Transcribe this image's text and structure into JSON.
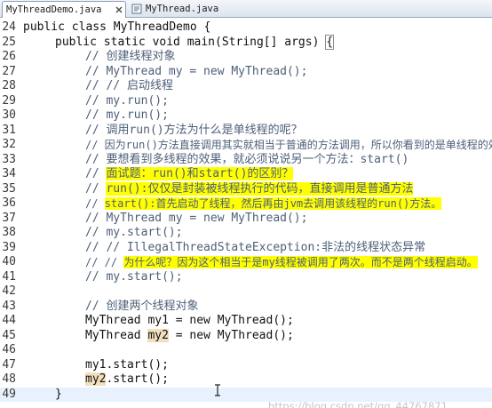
{
  "tabs": [
    {
      "label": "MyThreadDemo.java",
      "active": true,
      "close_icon": "close-icon"
    },
    {
      "label": "MyThread.java",
      "active": false,
      "icon": "java-file-icon"
    }
  ],
  "editor": {
    "lines": [
      {
        "number": "24",
        "text": "public class MyThreadDemo {",
        "kind": "code"
      },
      {
        "number": "25",
        "text": "public static void main(String[] args) ",
        "bracket": "{",
        "kind": "code"
      },
      {
        "number": "26",
        "text": "// 创建线程对象",
        "kind": "comment"
      },
      {
        "number": "27",
        "text": "// MyThread my = new MyThread();",
        "kind": "comment"
      },
      {
        "number": "28",
        "text": "// // 启动线程",
        "kind": "comment"
      },
      {
        "number": "29",
        "text": "// my.run();",
        "kind": "comment"
      },
      {
        "number": "30",
        "text": "// my.run();",
        "kind": "comment"
      },
      {
        "number": "31",
        "text": "// 调用run()方法为什么是单线程的呢？",
        "kind": "comment"
      },
      {
        "number": "32",
        "text": "// 因为run()方法直接调用其实就相当于普通的方法调用，所以你看到的是单线程的效果",
        "kind": "comment"
      },
      {
        "number": "33",
        "text": "// 要想看到多线程的效果，就必须说说另一个方法：start()",
        "kind": "comment"
      },
      {
        "number": "34",
        "prefix": "// ",
        "text": "面试题：run()和start()的区别？",
        "kind": "comment",
        "highlight": true
      },
      {
        "number": "35",
        "prefix": "// ",
        "text": "run():仅仅是封装被线程执行的代码，直接调用是普通方法",
        "kind": "comment",
        "highlight": true
      },
      {
        "number": "36",
        "prefix": "// ",
        "text": "start():首先启动了线程，然后再由jvm去调用该线程的run()方法。",
        "kind": "comment",
        "highlight": true
      },
      {
        "number": "37",
        "text": "// MyThread my = new MyThread();",
        "kind": "comment"
      },
      {
        "number": "38",
        "text": "// my.start();",
        "kind": "comment"
      },
      {
        "number": "39",
        "text": "// // IllegalThreadStateException:非法的线程状态异常",
        "kind": "comment"
      },
      {
        "number": "40",
        "prefix": "// // ",
        "text": "为什么呢？因为这个相当于是my线程被调用了两次。而不是两个线程启动。",
        "kind": "comment",
        "highlight": true
      },
      {
        "number": "41",
        "text": "// my.start();",
        "kind": "comment"
      },
      {
        "number": "42",
        "text": "",
        "kind": "code"
      },
      {
        "number": "43",
        "text": "// 创建两个线程对象",
        "kind": "comment"
      },
      {
        "number": "44",
        "text": "MyThread my1 = new MyThread();",
        "kind": "code"
      },
      {
        "number": "45",
        "before": "MyThread ",
        "var": "my2",
        "after": " = new MyThread();",
        "kind": "code"
      },
      {
        "number": "46",
        "text": "",
        "kind": "code"
      },
      {
        "number": "47",
        "text": "my1.start();",
        "kind": "code"
      },
      {
        "number": "48",
        "var": "my2",
        "after": ".start();",
        "kind": "code"
      },
      {
        "number": "49",
        "text": "}",
        "kind": "code"
      }
    ]
  },
  "watermark": "https://blog.csdn.net/qq_44767871",
  "colors": {
    "comment": "#4d5f78",
    "highlight": "#ffff00",
    "var_highlight": "#f1dfbe",
    "current_line": "#e8f2fe"
  }
}
